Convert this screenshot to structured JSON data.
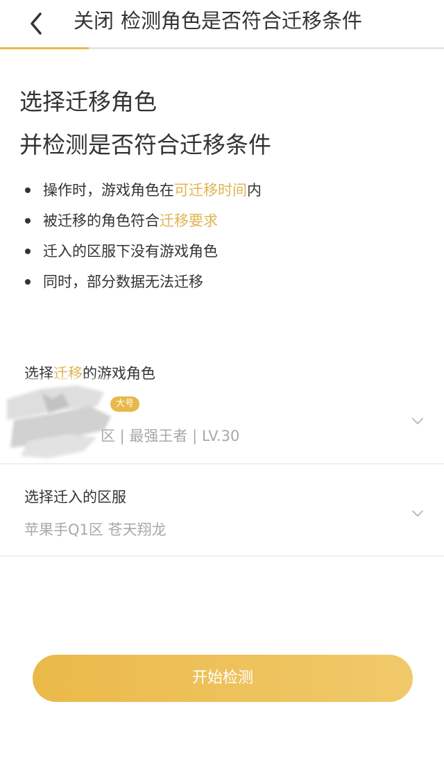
{
  "header": {
    "close_label": "关闭",
    "title": "检测角色是否符合迁移条件",
    "progress": 0.2
  },
  "headline": {
    "line1": "选择迁移角色",
    "line2": "并检测是否符合迁移条件"
  },
  "bullets": [
    {
      "before": "操作时，游戏角色在",
      "highlight": "可迁移时间",
      "after": "内"
    },
    {
      "before": "被迁移的角色符合",
      "highlight": "迁移要求",
      "after": ""
    },
    {
      "before": "迁入的区服下没有游戏角色",
      "highlight": "",
      "after": ""
    },
    {
      "before": "同时，部分数据无法迁移",
      "highlight": "",
      "after": ""
    }
  ],
  "role_section": {
    "label_before": "选择",
    "label_highlight": "迁移",
    "label_after": "的游戏角色",
    "badge": "大号",
    "info": "区 | 最强王者 | LV.30"
  },
  "server_section": {
    "label": "选择迁入的区服",
    "value": "苹果手Q1区 苍天翔龙"
  },
  "start_button": "开始检测",
  "colors": {
    "accent": "#e8b84a",
    "highlight_text": "#e0b450",
    "button_start": "#ebb94a",
    "button_end": "#f0c96a"
  },
  "icons": {
    "back": "chevron-left-icon",
    "dropdown": "chevron-down-icon"
  }
}
